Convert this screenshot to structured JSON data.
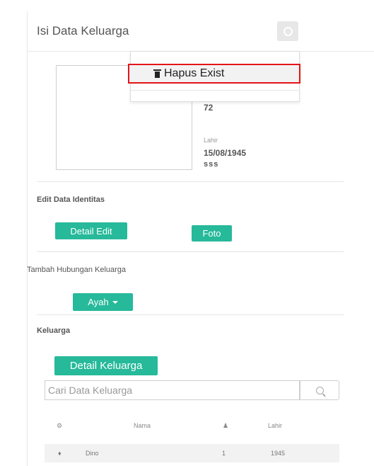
{
  "header": {
    "title": "Isi Data Keluarga"
  },
  "dropdown": {
    "items": [
      {
        "label": "Hapus Exist",
        "icon": "trash-icon"
      }
    ]
  },
  "profile": {
    "age": "72",
    "birth_label": "Lahir",
    "birth_date": "15/08/1945",
    "extra": "sss"
  },
  "edit_section": {
    "title": "Edit Data Identitas",
    "edit_button": "Detail Edit",
    "photo_button": "Foto"
  },
  "relation_section": {
    "title": "Tambah Hubungan Keluarga",
    "select_value": "Ayah"
  },
  "family_section": {
    "title": "Keluarga",
    "detail_button": "Detail Keluarga",
    "search_placeholder": "Cari Data Keluarga",
    "table": {
      "columns": [
        "Nama",
        "Lahir"
      ],
      "rows": [
        {
          "name": "Dino",
          "count": "1",
          "year": "1945"
        }
      ]
    }
  },
  "colors": {
    "accent": "#26b99a",
    "highlight": "#e3141a"
  }
}
